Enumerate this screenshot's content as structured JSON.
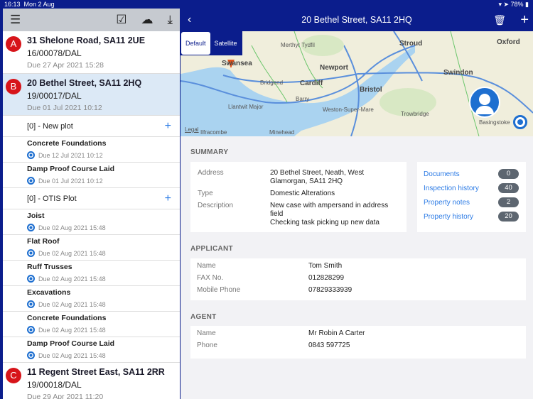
{
  "status": {
    "time": "16:13",
    "date": "Mon 2 Aug",
    "battery": "78%"
  },
  "list": {
    "properties": [
      {
        "badge": "A",
        "title": "31 Shelone Road, SA11 2UE",
        "ref": "16/00078/DAL",
        "due": "Due 27 Apr 2021 15:28"
      },
      {
        "badge": "B",
        "title": "20 Bethel Street, SA11 2HQ",
        "ref": "19/00017/DAL",
        "due": "Due 01 Jul 2021 10:12"
      },
      {
        "badge": "C",
        "title": "11 Regent Street East, SA11 2RR",
        "ref": "19/00018/DAL",
        "due": "Due 29 Apr 2021 11:20"
      }
    ],
    "plots": [
      {
        "label": "[0] - New plot",
        "tasks": [
          {
            "name": "Concrete Foundations",
            "due": "Due 12 Jul 2021 10:12"
          },
          {
            "name": "Damp Proof Course Laid",
            "due": "Due 01 Jul 2021 10:12"
          }
        ]
      },
      {
        "label": "[0] - OTIS Plot",
        "tasks": [
          {
            "name": "Joist",
            "due": "Due 02 Aug 2021 15:48"
          },
          {
            "name": "Flat Roof",
            "due": "Due 02 Aug 2021 15:48"
          },
          {
            "name": "Ruff Trusses",
            "due": "Due 02 Aug 2021 15:48"
          },
          {
            "name": "Excavations",
            "due": "Due 02 Aug 2021 15:48"
          },
          {
            "name": "Concrete Foundations",
            "due": "Due 02 Aug 2021 15:48"
          },
          {
            "name": "Damp Proof Course Laid",
            "due": "Due 02 Aug 2021 15:48"
          }
        ]
      }
    ]
  },
  "detail": {
    "title": "20 Bethel Street, SA11 2HQ",
    "map": {
      "default": "Default",
      "satellite": "Satellite",
      "legal": "Legal",
      "labels": [
        "Swansea",
        "Cardiff",
        "Newport",
        "Bristol",
        "Swindon",
        "Stroud",
        "Oxford",
        "Merthyr Tydfil",
        "Bridgend",
        "Barry",
        "Weston-Super-Mare",
        "Trowbridge",
        "Basingstoke",
        "Minehead",
        "Ilfracombe",
        "Llantwit Major"
      ]
    },
    "summary": {
      "heading": "SUMMARY",
      "address_label": "Address",
      "address": "20 Bethel Street, Neath, West Glamorgan, SA11 2HQ",
      "type_label": "Type",
      "type": "Domestic Alterations",
      "description_label": "Description",
      "description1": "New case with ampersand in address field",
      "description2": "Checking task picking up new data"
    },
    "links": [
      {
        "label": "Documents",
        "count": "0"
      },
      {
        "label": "Inspection history",
        "count": "40"
      },
      {
        "label": "Property notes",
        "count": "2"
      },
      {
        "label": "Property history",
        "count": "20"
      }
    ],
    "applicant": {
      "heading": "APPLICANT",
      "name_label": "Name",
      "name": "Tom Smith",
      "fax_label": "FAX No.",
      "fax": "012828299",
      "mobile_label": "Mobile Phone",
      "mobile": "07829333939"
    },
    "agent": {
      "heading": "AGENT",
      "name_label": "Name",
      "name": "Mr Robin A Carter",
      "phone_label": "Phone",
      "phone": "0843 597725"
    }
  }
}
